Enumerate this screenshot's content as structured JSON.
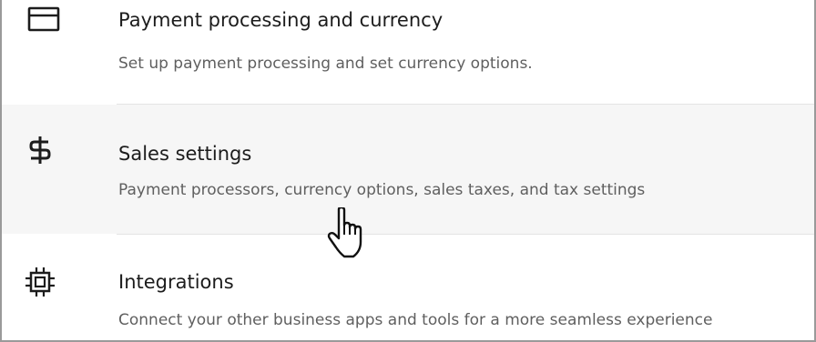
{
  "settings_list": {
    "items": [
      {
        "icon": "card-icon",
        "title": "Payment processing and currency",
        "description": "Set up payment processing and set currency options."
      },
      {
        "icon": "dollar-icon",
        "title": "Sales settings",
        "description": "Payment processors, currency options, sales taxes, and tax settings",
        "hovered": true
      },
      {
        "icon": "chip-icon",
        "title": "Integrations",
        "description": "Connect your other business apps and tools for a more seamless experience"
      }
    ]
  },
  "colors": {
    "hover_background": "#f6f6f6",
    "title_text": "#1c1c1c",
    "description_text": "#5f5f5f"
  },
  "cursor": {
    "icon": "hand-pointer-cursor-icon"
  }
}
